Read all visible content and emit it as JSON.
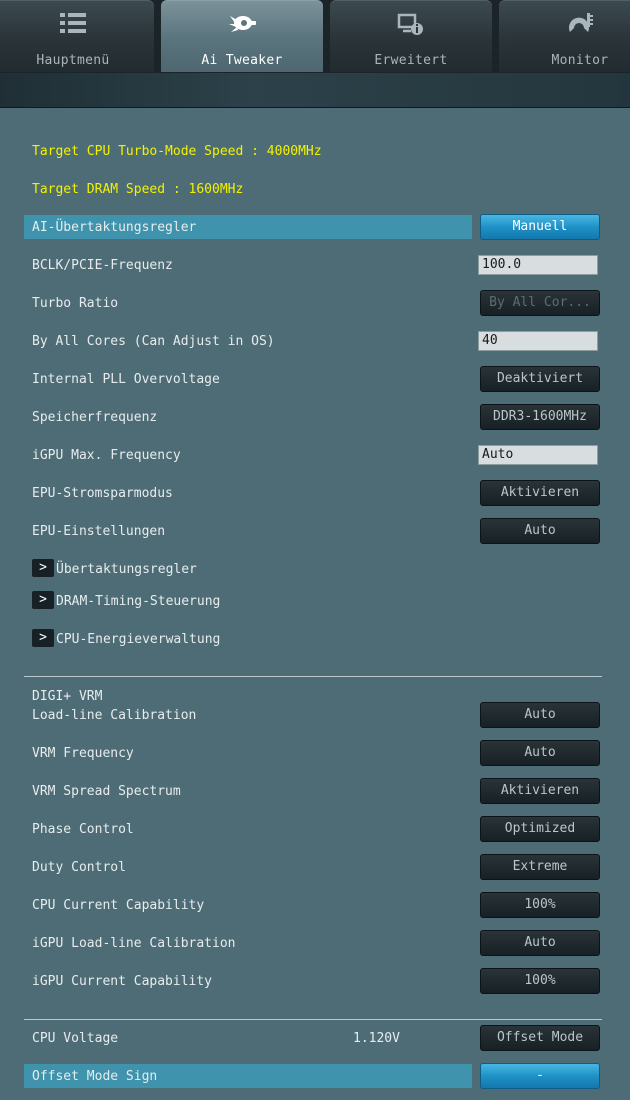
{
  "tabs": [
    {
      "label": "Hauptmenü",
      "icon": "list-icon",
      "active": false
    },
    {
      "label": "Ai Tweaker",
      "icon": "rocket-icon",
      "active": true
    },
    {
      "label": "Erweitert",
      "icon": "info-device-icon",
      "active": false
    },
    {
      "label": "Monitor",
      "icon": "gauge-icon",
      "active": false
    }
  ],
  "info": {
    "target_cpu": "Target CPU Turbo-Mode Speed : 4000MHz",
    "target_dram": "Target DRAM Speed : 1600MHz"
  },
  "settings": [
    {
      "label": "AI-Übertaktungsregler",
      "value": "Manuell"
    },
    {
      "label": "BCLK/PCIE-Frequenz",
      "value": "100.0"
    },
    {
      "label": "Turbo Ratio",
      "value": "By All Cor..."
    },
    {
      "label": "By All Cores (Can Adjust in OS)",
      "value": "40"
    },
    {
      "label": "Internal PLL Overvoltage",
      "value": "Deaktiviert"
    },
    {
      "label": "Speicherfrequenz",
      "value": "DDR3-1600MHz"
    },
    {
      "label": "iGPU Max. Frequency",
      "value": "Auto"
    },
    {
      "label": "EPU-Stromsparmodus",
      "value": "Aktivieren"
    },
    {
      "label": "EPU-Einstellungen",
      "value": "Auto"
    }
  ],
  "submenus": [
    {
      "label": "Übertaktungsregler",
      "arrow": ">"
    },
    {
      "label": "DRAM-Timing-Steuerung",
      "arrow": ">"
    },
    {
      "label": "CPU-Energieverwaltung",
      "arrow": ">"
    }
  ],
  "digi": {
    "header": "DIGI+ VRM",
    "items": [
      {
        "label": "Load-line Calibration",
        "value": "Auto"
      },
      {
        "label": "VRM Frequency",
        "value": "Auto"
      },
      {
        "label": "VRM Spread Spectrum",
        "value": "Aktivieren"
      },
      {
        "label": "Phase Control",
        "value": "Optimized"
      },
      {
        "label": "Duty Control",
        "value": "Extreme"
      },
      {
        "label": "CPU Current Capability",
        "value": "100%"
      },
      {
        "label": "iGPU Load-line Calibration",
        "value": "Auto"
      },
      {
        "label": "iGPU Current Capability",
        "value": "100%"
      }
    ]
  },
  "voltage": {
    "label": "CPU Voltage",
    "reading": "1.120V",
    "mode": "Offset Mode",
    "sign_label": "Offset Mode Sign",
    "sign_value": "-"
  },
  "colors": {
    "highlight": "#3f93ad",
    "accent_button": "#1c8ec4",
    "info_text": "#f2f200",
    "panel_bg": "#4e6c75"
  }
}
